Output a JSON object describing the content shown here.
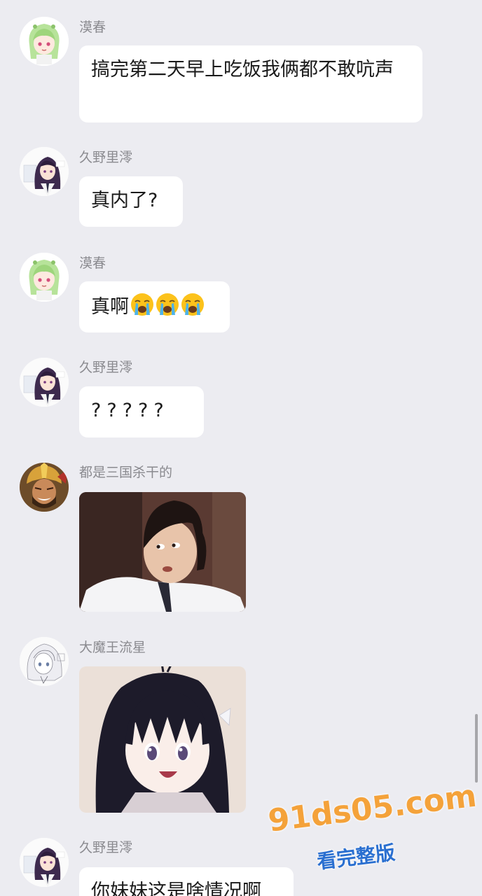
{
  "messages": [
    {
      "sender": "漠春",
      "text": "搞完第二天早上吃饭我俩都不敢吭声",
      "avatar": "green-hair-anime-avatar"
    },
    {
      "sender": "久野里澪",
      "text": "真内了?",
      "avatar": "dark-hair-anime-avatar"
    },
    {
      "sender": "漠春",
      "text": "真啊",
      "emoji": [
        "loudly-crying-face",
        "loudly-crying-face",
        "loudly-crying-face"
      ],
      "avatar": "green-hair-anime-avatar"
    },
    {
      "sender": "久野里澪",
      "text": "?????",
      "avatar": "dark-hair-anime-avatar"
    },
    {
      "sender": "都是三国杀干的",
      "sticker": "man-nervous-glance-photo",
      "avatar": "warrior-helmet-avatar"
    },
    {
      "sender": "大魔王流星",
      "sticker": "anime-girl-dark-hair-smiling",
      "avatar": "white-hair-sketch-avatar"
    },
    {
      "sender": "久野里澪",
      "text": "你妹妹这是啥情况啊",
      "avatar": "dark-hair-anime-avatar"
    }
  ],
  "watermark": {
    "main": "91ds05.com",
    "sub": "看完整版",
    "main_color": "#f4a23a",
    "sub_color": "#2a6fd0"
  },
  "colors": {
    "background": "#ececf1",
    "bubble": "#ffffff",
    "sender_name": "#8a8a8f"
  }
}
